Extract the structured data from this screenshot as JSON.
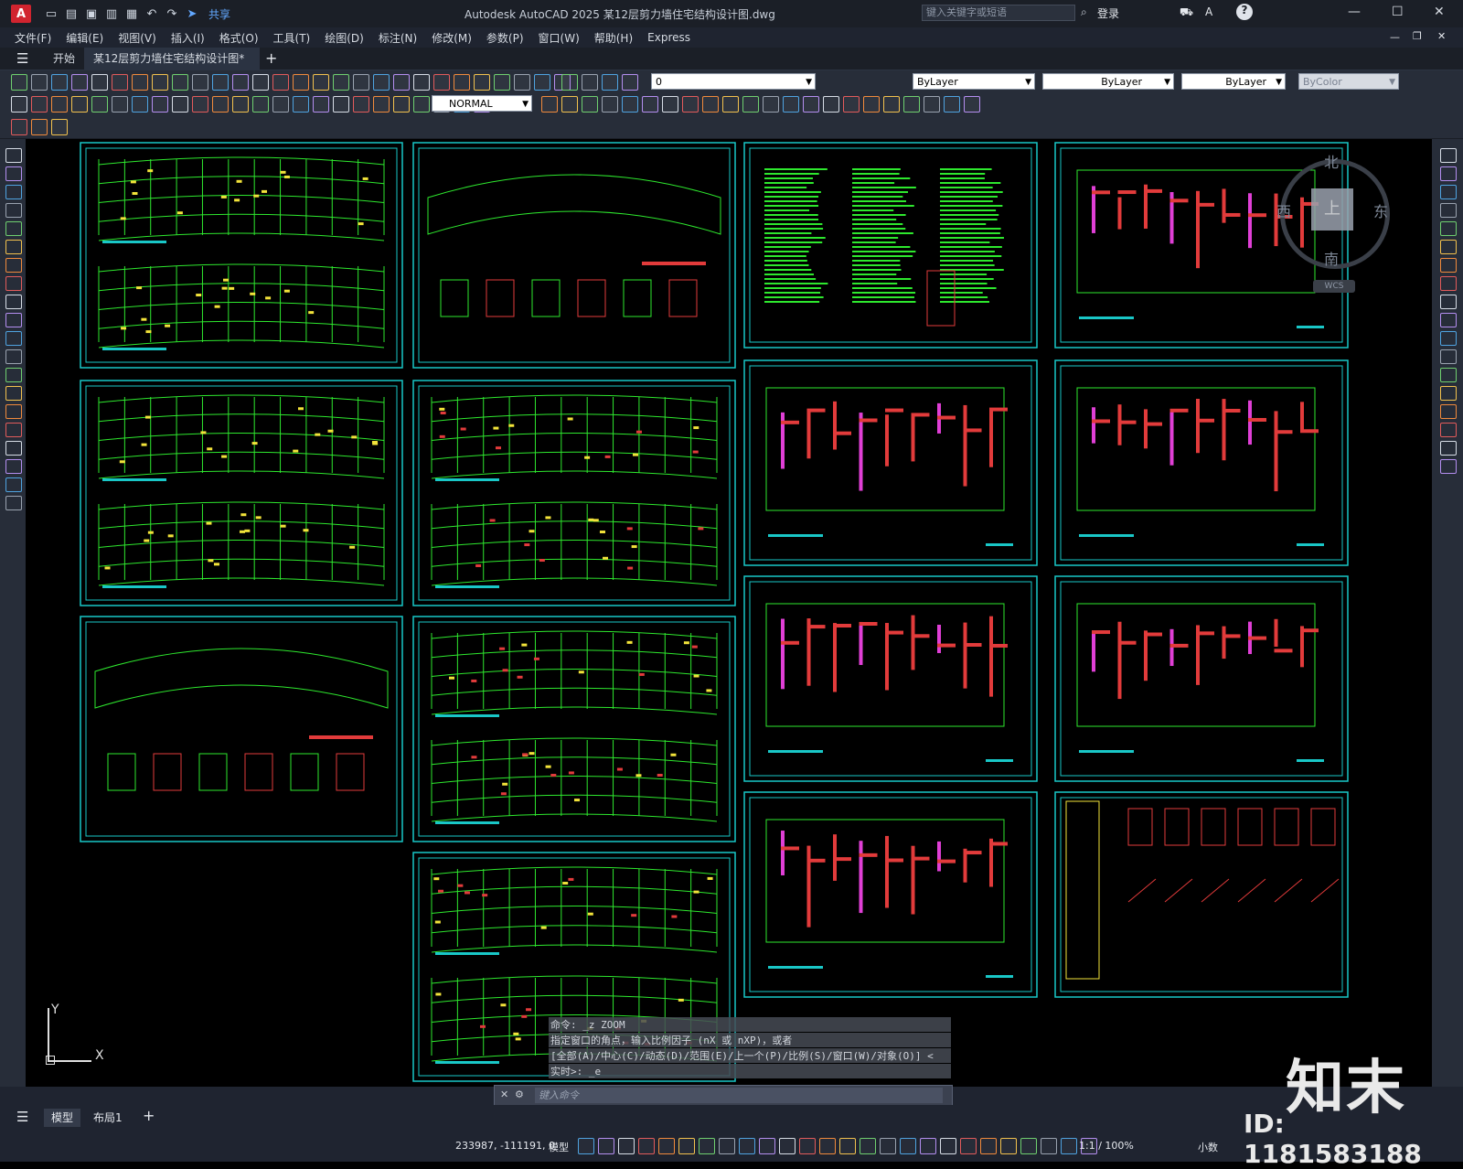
{
  "title_bar": {
    "app_icon": "A",
    "share_label": "共享",
    "window_title": "Autodesk AutoCAD 2025    某12层剪力墙住宅结构设计图.dwg",
    "search_placeholder": "键入关键字或短语",
    "login_label": "登录",
    "help_icon": "?"
  },
  "menu": [
    "文件(F)",
    "编辑(E)",
    "视图(V)",
    "插入(I)",
    "格式(O)",
    "工具(T)",
    "绘图(D)",
    "标注(N)",
    "修改(M)",
    "参数(P)",
    "窗口(W)",
    "帮助(H)",
    "Express"
  ],
  "doc_tabs": {
    "start": "开始",
    "active": "某12层剪力墙住宅结构设计图*",
    "close": "×",
    "add": "+"
  },
  "properties": {
    "layer": "0",
    "color": "ByLayer",
    "linetype": "ByLayer",
    "lineweight": "ByLayer",
    "plotstyle": "ByColor",
    "dimstyle": "NORMAL"
  },
  "viewcube": {
    "north": "北",
    "south": "南",
    "east": "东",
    "west": "西",
    "top": "上",
    "wcs": "WCS"
  },
  "ucs": {
    "x": "X",
    "y": "Y"
  },
  "command": {
    "history": [
      "命令: _z ZOOM",
      "指定窗口的角点，输入比例因子 (nX 或 nXP)，或者",
      "[全部(A)/中心(C)/动态(D)/范围(E)/上一个(P)/比例(S)/窗口(W)/对象(O)] <",
      "实时>:  _e"
    ],
    "placeholder": "键入命令"
  },
  "layout_tabs": {
    "model": "模型",
    "layout1": "布局1",
    "add": "+"
  },
  "status": {
    "coords": "233987, -111191, 0",
    "space": "模型",
    "scale": "1:1 / 100%",
    "units": "小数"
  },
  "watermark": {
    "brand": "知末",
    "id": "ID: 1181583188"
  }
}
